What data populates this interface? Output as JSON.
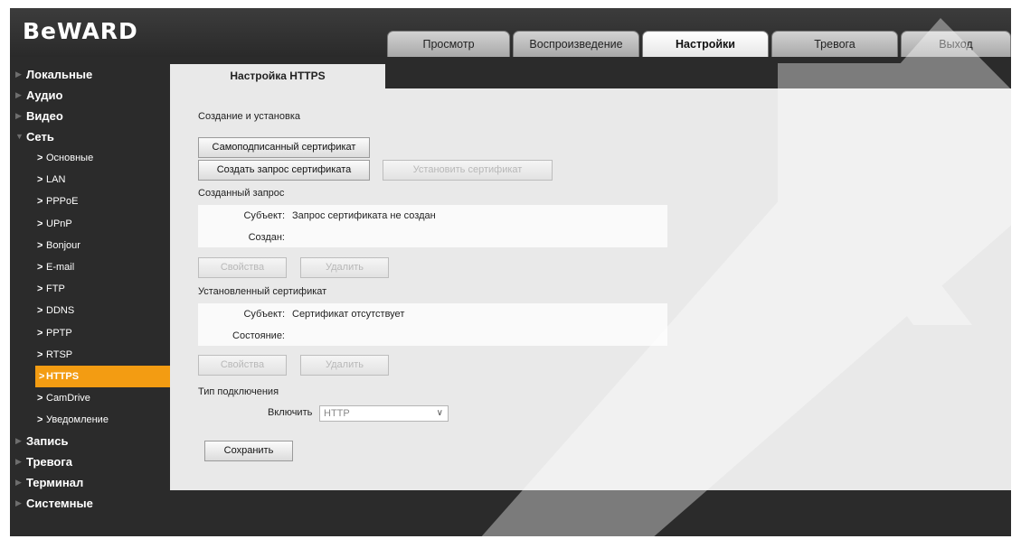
{
  "logo": "BeWARD",
  "tabs": [
    {
      "label": "Просмотр",
      "active": false
    },
    {
      "label": "Воспроизведение",
      "active": false
    },
    {
      "label": "Настройки",
      "active": true
    },
    {
      "label": "Тревога",
      "active": false
    },
    {
      "label": "Выход",
      "active": false
    }
  ],
  "sidebar": {
    "top_items": [
      "Локальные",
      "Аудио",
      "Видео",
      "Сеть"
    ],
    "network_sub": [
      "Основные",
      "LAN",
      "PPPoE",
      "UPnP",
      "Bonjour",
      "E-mail",
      "FTP",
      "DDNS",
      "PPTP",
      "RTSP",
      "HTTPS",
      "CamDrive",
      "Уведомление"
    ],
    "active_sub": "HTTPS",
    "bottom_items": [
      "Запись",
      "Тревога",
      "Терминал",
      "Системные"
    ]
  },
  "page": {
    "tab_title": "Настройка HTTPS",
    "section_create": "Создание и установка",
    "btn_selfsigned": "Самоподписанный сертификат",
    "btn_create_request": "Создать запрос сертификата",
    "btn_install_cert": "Установить сертификат",
    "section_request": "Созданный запрос",
    "request": {
      "subject_label": "Субъект:",
      "subject_value": "Запрос сертификата не создан",
      "created_label": "Создан:",
      "created_value": ""
    },
    "btn_properties": "Свойства",
    "btn_delete": "Удалить",
    "section_installed": "Установленный сертификат",
    "installed": {
      "subject_label": "Субъект:",
      "subject_value": "Сертификат отсутствует",
      "status_label": "Состояние:",
      "status_value": ""
    },
    "section_connection": "Тип подключения",
    "enable_label": "Включить",
    "enable_value": "HTTP",
    "btn_save": "Сохранить"
  },
  "colors": {
    "accent": "#f39c12",
    "background": "#2b2b2b",
    "panel": "#e9e9e9"
  }
}
